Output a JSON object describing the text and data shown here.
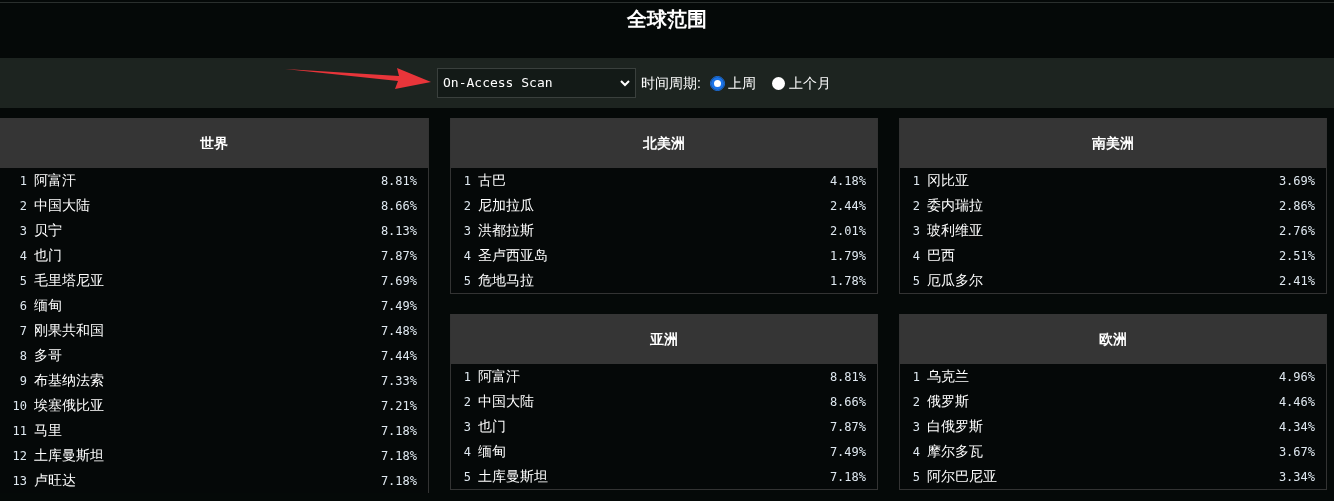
{
  "title": "全球范围",
  "toolbar": {
    "scan_select": {
      "value": "On-Access Scan"
    },
    "period_label": "时间周期:",
    "period_options": [
      {
        "label": "上周",
        "selected": true
      },
      {
        "label": "上个月",
        "selected": false
      }
    ]
  },
  "panels": [
    {
      "title": "世界",
      "rows": [
        {
          "rank": "1",
          "name": "阿富汗",
          "value": "8.81%"
        },
        {
          "rank": "2",
          "name": "中国大陆",
          "value": "8.66%"
        },
        {
          "rank": "3",
          "name": "贝宁",
          "value": "8.13%"
        },
        {
          "rank": "4",
          "name": "也门",
          "value": "7.87%"
        },
        {
          "rank": "5",
          "name": "毛里塔尼亚",
          "value": "7.69%"
        },
        {
          "rank": "6",
          "name": "缅甸",
          "value": "7.49%"
        },
        {
          "rank": "7",
          "name": "刚果共和国",
          "value": "7.48%"
        },
        {
          "rank": "8",
          "name": "多哥",
          "value": "7.44%"
        },
        {
          "rank": "9",
          "name": "布基纳法索",
          "value": "7.33%"
        },
        {
          "rank": "10",
          "name": "埃塞俄比亚",
          "value": "7.21%"
        },
        {
          "rank": "11",
          "name": "马里",
          "value": "7.18%"
        },
        {
          "rank": "12",
          "name": "土库曼斯坦",
          "value": "7.18%"
        },
        {
          "rank": "13",
          "name": "卢旺达",
          "value": "7.18%"
        }
      ]
    },
    {
      "title": "北美洲",
      "rows": [
        {
          "rank": "1",
          "name": "古巴",
          "value": "4.18%"
        },
        {
          "rank": "2",
          "name": "尼加拉瓜",
          "value": "2.44%"
        },
        {
          "rank": "3",
          "name": "洪都拉斯",
          "value": "2.01%"
        },
        {
          "rank": "4",
          "name": "圣卢西亚岛",
          "value": "1.79%"
        },
        {
          "rank": "5",
          "name": "危地马拉",
          "value": "1.78%"
        }
      ]
    },
    {
      "title": "南美洲",
      "rows": [
        {
          "rank": "1",
          "name": "冈比亚",
          "value": "3.69%"
        },
        {
          "rank": "2",
          "name": "委内瑞拉",
          "value": "2.86%"
        },
        {
          "rank": "3",
          "name": "玻利维亚",
          "value": "2.76%"
        },
        {
          "rank": "4",
          "name": "巴西",
          "value": "2.51%"
        },
        {
          "rank": "5",
          "name": "厄瓜多尔",
          "value": "2.41%"
        }
      ]
    },
    {
      "title": "亚洲",
      "rows": [
        {
          "rank": "1",
          "name": "阿富汗",
          "value": "8.81%"
        },
        {
          "rank": "2",
          "name": "中国大陆",
          "value": "8.66%"
        },
        {
          "rank": "3",
          "name": "也门",
          "value": "7.87%"
        },
        {
          "rank": "4",
          "name": "缅甸",
          "value": "7.49%"
        },
        {
          "rank": "5",
          "name": "土库曼斯坦",
          "value": "7.18%"
        }
      ]
    },
    {
      "title": "欧洲",
      "rows": [
        {
          "rank": "1",
          "name": "乌克兰",
          "value": "4.96%"
        },
        {
          "rank": "2",
          "name": "俄罗斯",
          "value": "4.46%"
        },
        {
          "rank": "3",
          "name": "白俄罗斯",
          "value": "4.34%"
        },
        {
          "rank": "4",
          "name": "摩尔多瓦",
          "value": "3.67%"
        },
        {
          "rank": "5",
          "name": "阿尔巴尼亚",
          "value": "3.34%"
        }
      ]
    }
  ]
}
